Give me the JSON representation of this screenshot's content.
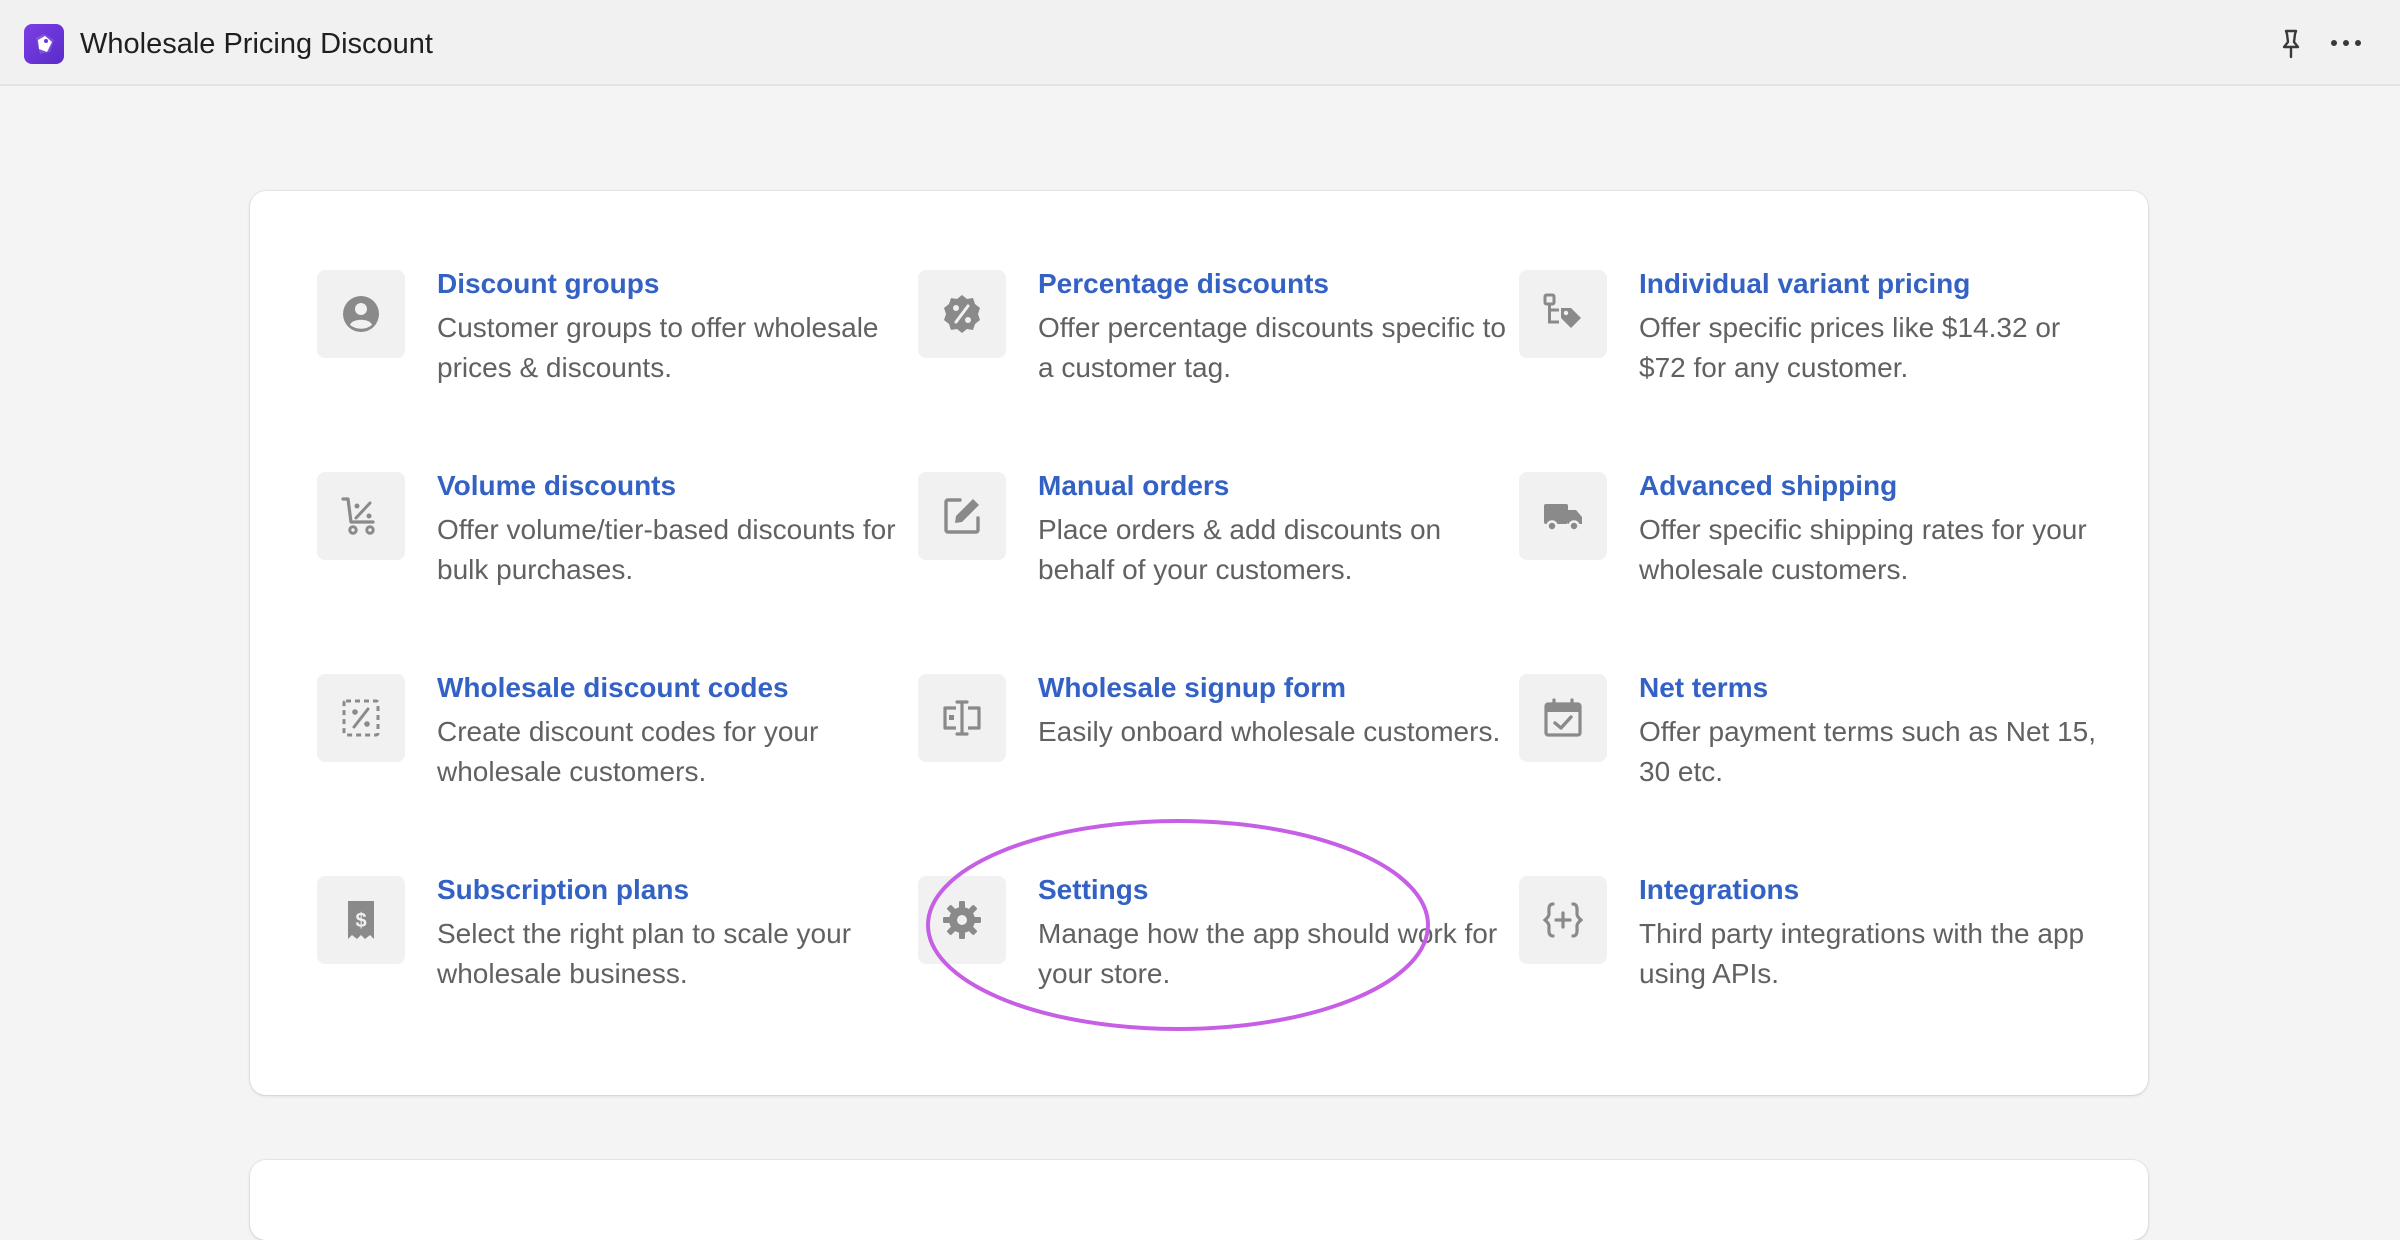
{
  "header": {
    "app_title": "Wholesale Pricing Discount",
    "brand_color": "#6a35d9"
  },
  "accent_color": "#3361c4",
  "annotation_color": "#c65ee6",
  "features": [
    {
      "title": "Discount groups",
      "desc": "Customer groups to offer wholesale prices & discounts.",
      "icon": "user-circle-icon"
    },
    {
      "title": "Percentage discounts",
      "desc": "Offer percentage discounts specific to a customer tag.",
      "icon": "percent-badge-icon"
    },
    {
      "title": "Individual variant pricing",
      "desc": "Offer specific prices like $14.32 or $72 for any customer.",
      "icon": "variant-tag-icon"
    },
    {
      "title": "Volume discounts",
      "desc": "Offer volume/tier-based discounts for bulk purchases.",
      "icon": "cart-discount-icon"
    },
    {
      "title": "Manual orders",
      "desc": "Place orders & add discounts on behalf of your customers.",
      "icon": "edit-order-icon"
    },
    {
      "title": "Advanced shipping",
      "desc": "Offer specific shipping rates for your wholesale customers.",
      "icon": "truck-icon"
    },
    {
      "title": "Wholesale discount codes",
      "desc": "Create discount codes for your wholesale customers.",
      "icon": "discount-code-icon"
    },
    {
      "title": "Wholesale signup form",
      "desc": "Easily onboard wholesale customers.",
      "icon": "signup-form-icon"
    },
    {
      "title": "Net terms",
      "desc": "Offer payment terms such as Net 15, 30 etc.",
      "icon": "calendar-check-icon"
    },
    {
      "title": "Subscription plans",
      "desc": "Select the right plan to scale your wholesale business.",
      "icon": "receipt-dollar-icon"
    },
    {
      "title": "Settings",
      "desc": "Manage how the app should work for your store.",
      "icon": "gear-icon"
    },
    {
      "title": "Integrations",
      "desc": "Third party integrations with the app using APIs.",
      "icon": "code-braces-icon"
    }
  ]
}
